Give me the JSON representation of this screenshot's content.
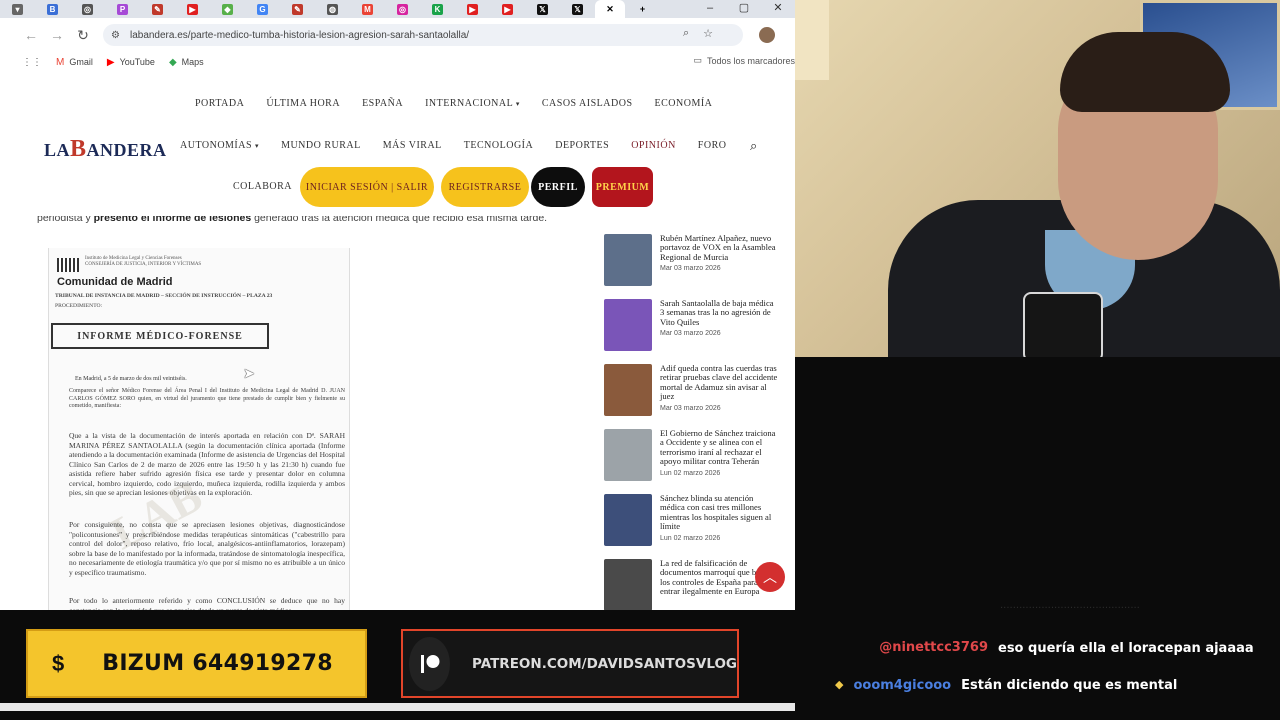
{
  "browser": {
    "url": "labandera.es/parte-medico-tumba-historia-lesion-agresion-sarah-santaolalla/",
    "bookmarks": [
      {
        "label": "Gmail",
        "icon": "gmail-icon",
        "color": "#ea4335"
      },
      {
        "label": "YouTube",
        "icon": "youtube-icon",
        "color": "#ff0000"
      },
      {
        "label": "Maps",
        "icon": "maps-icon",
        "color": "#34a853"
      }
    ],
    "all_bookmarks_label": "Todos los marcadores",
    "tabs": [
      {
        "icon": "chrome-icon",
        "glyph": "▾",
        "color": "#666"
      },
      {
        "icon": "b-icon",
        "glyph": "B",
        "color": "#3b6fd6"
      },
      {
        "icon": "g-icon",
        "glyph": "◎",
        "color": "#555"
      },
      {
        "icon": "p-icon",
        "glyph": "P",
        "color": "#a64ad6"
      },
      {
        "icon": "pencil-icon",
        "glyph": "✎",
        "color": "#c0392b"
      },
      {
        "icon": "youtube-icon",
        "glyph": "▶",
        "color": "#e02020"
      },
      {
        "icon": "leaf-icon",
        "glyph": "◆",
        "color": "#58b04a"
      },
      {
        "icon": "google-icon",
        "glyph": "G",
        "color": "#4285f4"
      },
      {
        "icon": "pencil-icon",
        "glyph": "✎",
        "color": "#c0392b"
      },
      {
        "icon": "globe-icon",
        "glyph": "◍",
        "color": "#555"
      },
      {
        "icon": "gmail-icon",
        "glyph": "M",
        "color": "#ea4335"
      },
      {
        "icon": "instagram-icon",
        "glyph": "◎",
        "color": "#d6249f"
      },
      {
        "icon": "kick-icon",
        "glyph": "K",
        "color": "#1aa34a"
      },
      {
        "icon": "youtube-icon",
        "glyph": "▶",
        "color": "#e02020"
      },
      {
        "icon": "youtube-icon",
        "glyph": "▶",
        "color": "#e02020"
      },
      {
        "icon": "x-icon",
        "glyph": "𝕏",
        "color": "#111"
      },
      {
        "icon": "x-icon",
        "glyph": "𝕏",
        "color": "#111"
      }
    ]
  },
  "site": {
    "logo_pre": "LA",
    "logo_big": "B",
    "logo_post": "ANDERA",
    "nav_row1": [
      "PORTADA",
      "ÚLTIMA HORA",
      "ESPAÑA",
      "INTERNACIONAL",
      "CASOS AISLADOS",
      "ECONOMÍA"
    ],
    "nav_row2": [
      "AUTONOMÍAS",
      "MUNDO RURAL",
      "MÁS VIRAL",
      "TECNOLOGÍA",
      "DEPORTES",
      "OPINIÓN",
      "FORO"
    ],
    "collab": "COLABORA",
    "login": "INICIAR SESIÓN | SALIR",
    "register": "REGISTRARSE",
    "profile": "PERFIL",
    "premium": "PREMIUM",
    "lead_pre": "periodista y ",
    "lead_bold": "presento el informe de lesiones",
    "lead_post": " generado tras la atención médica que recibió esa misma tarde."
  },
  "doc": {
    "header_small": "Instituto de Medicina Legal y Ciencias Forenses\nCONSEJERÍA DE JUSTICIA, INTERIOR Y VÍCTIMAS",
    "region": "Comunidad de Madrid",
    "court": "TRIBUNAL DE INSTANCIA DE MADRID – SECCIÓN DE INSTRUCCIÓN – PLAZA 23",
    "proc": "PROCEDIMIENTO:",
    "title": "INFORME MÉDICO-FORENSE",
    "date": "En Madrid, a 5 de marzo de dos mil veintiséis.",
    "p1": "Comparece el señor Médico Forense del Área Penal I del Instituto de Medicina Legal de Madrid D. JUAN CARLOS GÓMEZ SORO quien, en virtud del juramento que tiene prestado de cumplir bien y fielmente su cometido, manifiesta:",
    "p2": "Que a la vista de la documentación de interés aportada en relación con Dª. SARAH MARINA PÉREZ SANTAOLALLA (según la documentación clínica aportada (Informe atendiendo a la documentación examinada (Informe de asistencia de Urgencias del Hospital Clínico San Carlos de 2 de marzo de 2026 entre las 19:50 h y las 21:30 h) cuando fue asistida refiere haber sufrido agresión física ese tarde y presentar dolor en columna cervical, hombro izquierdo, codo izquierdo, muñeca izquierda, rodilla izquierda y ambos pies, sin que se aprecian lesiones objetivas en la exploración.",
    "p3": "Por consiguiente, no consta que se apreciasen lesiones objetivas, diagnosticándose \"policontusiones\" y prescribiéndose medidas terapéuticas sintomáticas (\"cabestrillo para control del dolor\", reposo relativo, frío local, analgésicos-antiinflamatorios, lorazepam) sobre la base de lo manifestado por la informada, tratándose de sintomatología inespecífica, no necesariamente de etiología traumática y/o que por sí mismo no es atribuible a un único y específico traumatismo.",
    "p4": "Por todo lo anteriormente referido y como CONCLUSIÓN se deduce que no hay constancia con la seguridad que se precisa desde un punto de vista médico-"
  },
  "sidebar": [
    {
      "title": "Rubén Martínez Alpañez, nuevo portavoz de VOX en la Asamblea Regional de Murcia",
      "date": "Mar 03 marzo 2026",
      "thumb": "#5d6f8a"
    },
    {
      "title": "Sarah Santaolalla de baja médica 3 semanas tras la no agresión de Vito Quiles",
      "date": "Mar 03 marzo 2026",
      "thumb": "#7a55b8"
    },
    {
      "title": "Adif queda contra las cuerdas tras retirar pruebas clave del accidente mortal de Adamuz sin avisar al juez",
      "date": "Mar 03 marzo 2026",
      "thumb": "#8a5a3c"
    },
    {
      "title": "El Gobierno de Sánchez traiciona a Occidente y se alinea con el terrorismo iraní al rechazar el apoyo militar contra Teherán",
      "date": "Lun 02 marzo 2026",
      "thumb": "#9ca3a8"
    },
    {
      "title": "Sánchez blinda su atención médica con casi tres millones mientras los hospitales siguen al límite",
      "date": "Lun 02 marzo 2026",
      "thumb": "#3d4f7a"
    },
    {
      "title": "La red de falsificación de documentos marroquí que burla los controles de España para entrar ilegalmente en Europa",
      "date": "",
      "thumb": "#4a4a4a"
    }
  ],
  "chat": {
    "faded": "............................................",
    "messages": [
      {
        "user": "@ninettcc3769",
        "text": "eso quería ella el loracepan ajaaaa",
        "color": "#e0484a"
      },
      {
        "user": "ooom4gicooo",
        "text": "Están diciendo que es mental",
        "color": "#4a7fe0"
      }
    ]
  },
  "banners": {
    "bizum": "BIZUM 644919278",
    "bizum_symbol": "$",
    "patreon": "PATREON.COM/DAVIDSANTOSVLOG"
  }
}
